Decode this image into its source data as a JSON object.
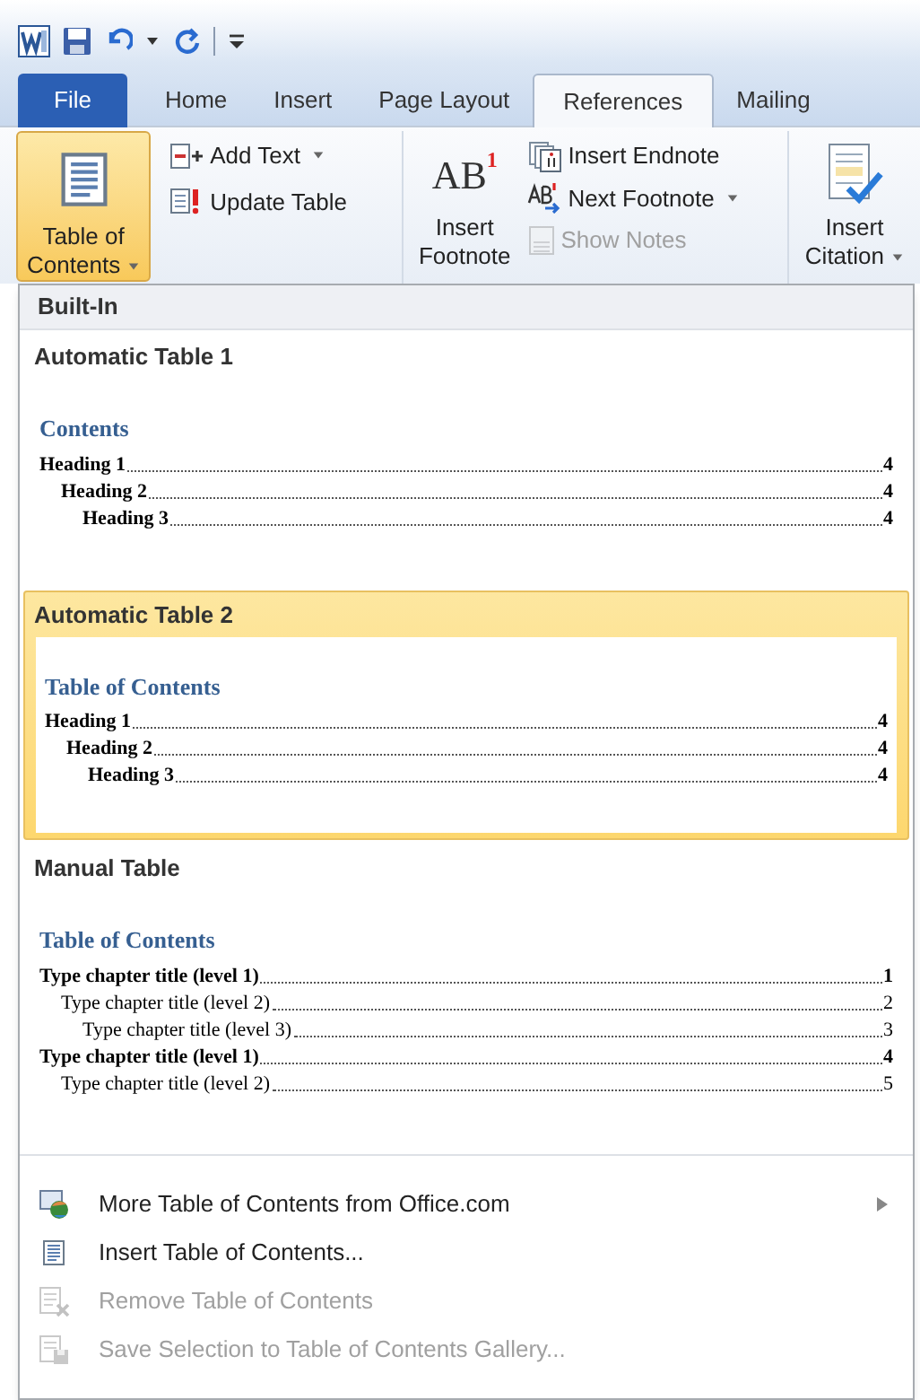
{
  "quick_access": {
    "items": [
      {
        "kind": "app"
      },
      {
        "kind": "save"
      },
      {
        "kind": "undo"
      },
      {
        "kind": "dropdown"
      },
      {
        "kind": "redo"
      },
      {
        "kind": "separator"
      },
      {
        "kind": "customize"
      }
    ]
  },
  "tabs": [
    {
      "label": "File",
      "kind": "file",
      "selected": false
    },
    {
      "label": "Home",
      "kind": "tab",
      "selected": false
    },
    {
      "label": "Insert",
      "kind": "tab",
      "selected": false
    },
    {
      "label": "Page Layout",
      "kind": "tab",
      "selected": false
    },
    {
      "label": "References",
      "kind": "tab",
      "selected": true
    },
    {
      "label": "Mailing",
      "kind": "tab",
      "selected": false
    }
  ],
  "ribbon": {
    "toc_button": {
      "label_lines": [
        "Table of",
        "Contents"
      ],
      "pressed": true
    },
    "small_buttons_1": [
      {
        "label": "Add Text",
        "kind": "add-text",
        "dropdown": true,
        "disabled": false
      },
      {
        "label": "Update Table",
        "kind": "update-table",
        "dropdown": false,
        "disabled": false
      }
    ],
    "footnote_button": {
      "icon_text": "AB",
      "icon_superscript": "1",
      "label_lines": [
        "Insert",
        "Footnote"
      ]
    },
    "small_buttons_2": [
      {
        "label": "Insert Endnote",
        "kind": "endnote",
        "dropdown": false,
        "disabled": false
      },
      {
        "label": "Next Footnote",
        "kind": "next-footnote",
        "dropdown": true,
        "disabled": false
      },
      {
        "label": "Show Notes",
        "kind": "show-notes",
        "dropdown": false,
        "disabled": true
      }
    ],
    "citation_button": {
      "label_lines": [
        "Insert",
        "Citation"
      ]
    }
  },
  "menu": {
    "section_header": "Built-In",
    "gallery": [
      {
        "name": "Automatic Table 1",
        "selected": false,
        "preview": {
          "title": "Contents",
          "entries": [
            {
              "text": "Heading 1",
              "page": "4",
              "bold": true,
              "children": [
                {
                  "text": "Heading 2",
                  "page": "4",
                  "bold": true,
                  "children": [
                    {
                      "text": "Heading 3",
                      "page": "4",
                      "bold": true
                    }
                  ]
                }
              ]
            }
          ]
        }
      },
      {
        "name": "Automatic Table 2",
        "selected": true,
        "preview": {
          "title": "Table of Contents",
          "entries": [
            {
              "text": "Heading 1",
              "page": "4",
              "bold": true,
              "children": [
                {
                  "text": "Heading 2",
                  "page": "4",
                  "bold": true,
                  "children": [
                    {
                      "text": "Heading 3",
                      "page": "4",
                      "bold": true
                    }
                  ]
                }
              ]
            }
          ]
        }
      },
      {
        "name": "Manual Table",
        "selected": false,
        "preview": {
          "title": "Table of Contents",
          "entries": [
            {
              "text": "Type chapter title (level 1)",
              "page": "1",
              "bold": true,
              "children": [
                {
                  "text": "Type chapter title (level 2)",
                  "page": "2",
                  "bold": false,
                  "children": [
                    {
                      "text": "Type chapter title (level 3)",
                      "page": "3",
                      "bold": false
                    }
                  ]
                }
              ]
            },
            {
              "text": "Type chapter title (level 1)",
              "page": "4",
              "bold": true,
              "children": [
                {
                  "text": "Type chapter title (level 2)",
                  "page": "5",
                  "bold": false
                }
              ]
            }
          ]
        }
      }
    ],
    "commands": [
      {
        "label": "More Table of Contents from Office.com",
        "kind": "office",
        "disabled": false,
        "submenu": true
      },
      {
        "label": "Insert Table of Contents...",
        "kind": "insert",
        "disabled": false,
        "submenu": false
      },
      {
        "label": "Remove Table of Contents",
        "kind": "remove",
        "disabled": true,
        "submenu": false
      },
      {
        "label": "Save Selection to Table of Contents Gallery...",
        "kind": "save",
        "disabled": true,
        "submenu": false
      }
    ]
  }
}
